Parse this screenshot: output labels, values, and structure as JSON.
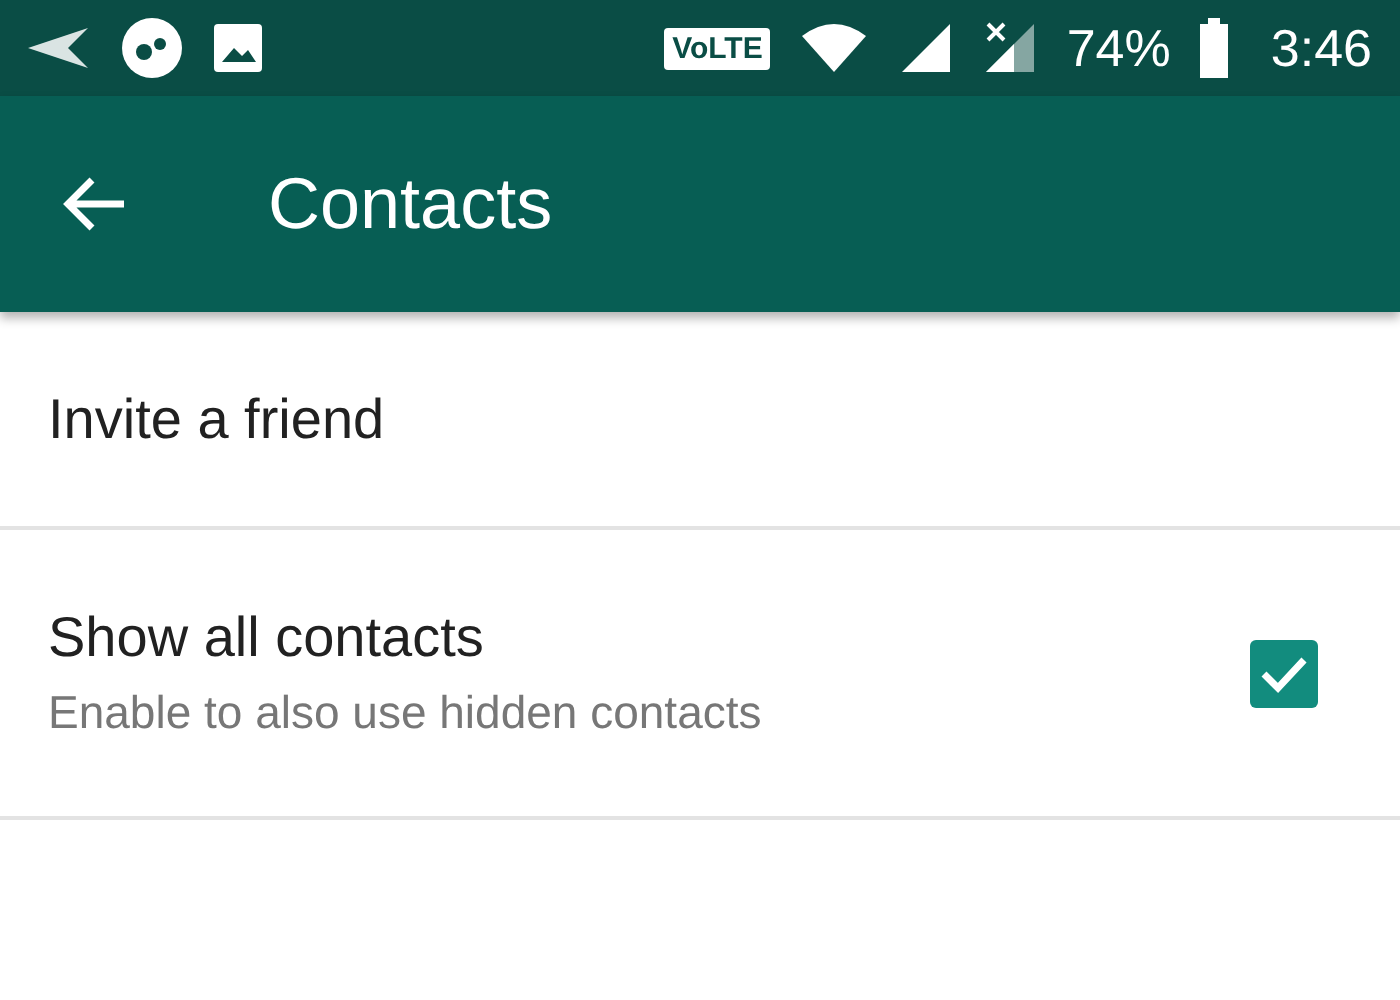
{
  "status_bar": {
    "volte": "VoLTE",
    "battery": "74%",
    "time": "3:46"
  },
  "app_bar": {
    "title": "Contacts"
  },
  "settings": [
    {
      "kind": "plain",
      "title": "Invite a friend"
    },
    {
      "kind": "checkbox",
      "title": "Show all contacts",
      "subtitle": "Enable to also use hidden contacts",
      "checked": true
    }
  ]
}
